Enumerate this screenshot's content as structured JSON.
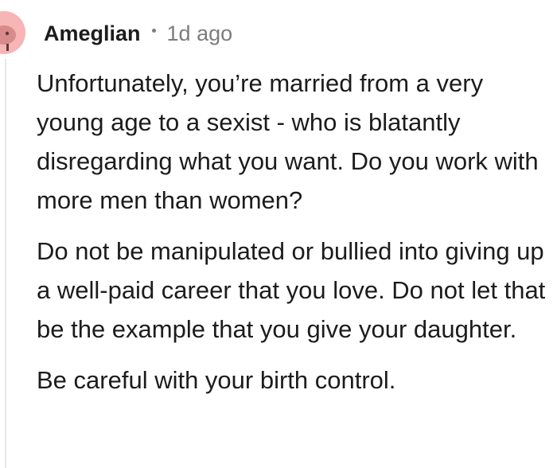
{
  "comment": {
    "author": "Ameglian",
    "separator": "•",
    "timestamp": "1d ago",
    "avatar_icon": "user-avatar-icon",
    "avatar_color": "#f7b5b5",
    "paragraphs": [
      "Unfortunately, you’re married from a very young age to a sexist - who is blatantly disregarding what you want. Do you work with more men than women?",
      "Do not be manipulated or bullied into giving up a well-paid career that you love. Do not let that be the example that you give your daughter.",
      "Be careful with your birth control."
    ]
  }
}
